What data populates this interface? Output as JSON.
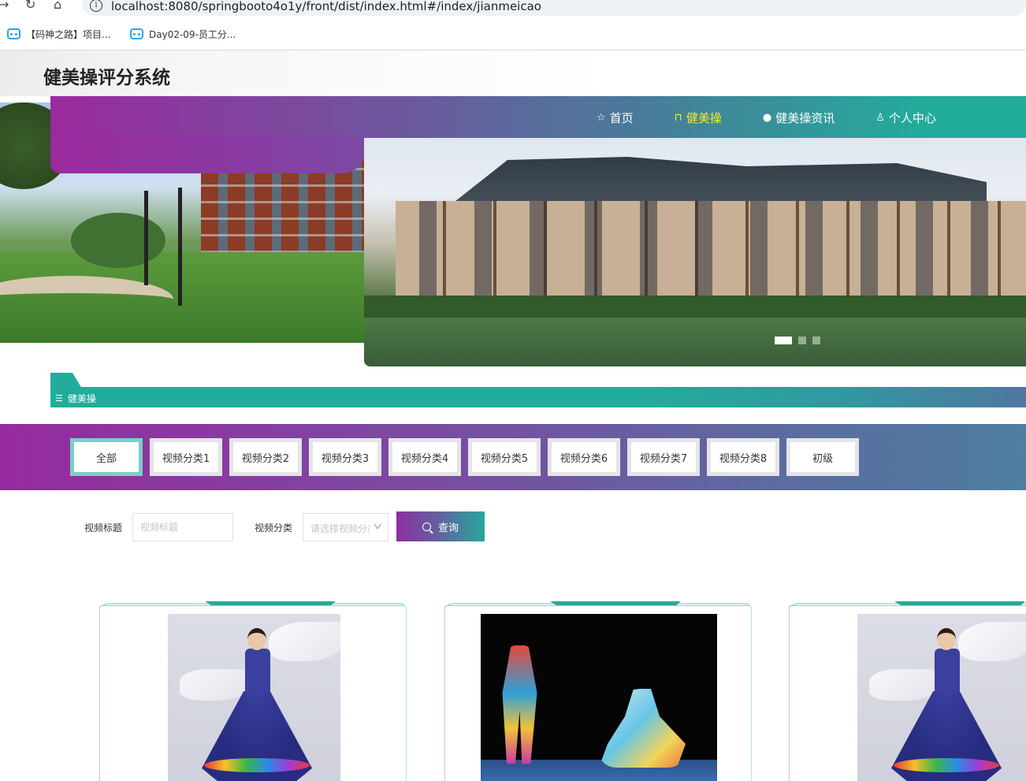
{
  "browser": {
    "url": "localhost:8080/springbooto4o1y/front/dist/index.html#/index/jianmeicao",
    "bookmarks": [
      {
        "label": "【码神之路】项目..."
      },
      {
        "label": "Day02-09-员工分..."
      }
    ]
  },
  "site": {
    "title": "健美操评分系统"
  },
  "nav": {
    "items": [
      {
        "label": "首页",
        "icon": "star-icon"
      },
      {
        "label": "健美操",
        "icon": "bag-icon",
        "active": true
      },
      {
        "label": "健美操资讯",
        "icon": "info-icon"
      },
      {
        "label": "个人中心",
        "icon": "user-icon"
      }
    ]
  },
  "carousel": {
    "slide_count": 3,
    "active_index": 0
  },
  "section": {
    "label": "健美操"
  },
  "categories": {
    "items": [
      "全部",
      "视频分类1",
      "视频分类2",
      "视频分类3",
      "视频分类4",
      "视频分类5",
      "视频分类6",
      "视频分类7",
      "视频分类8",
      "初级"
    ],
    "active_index": 0
  },
  "search": {
    "title_label": "视频标题",
    "title_placeholder": "视频标题",
    "category_label": "视频分类",
    "category_placeholder": "请选择视频分类",
    "button_label": "查询"
  },
  "colors": {
    "purple": "#962aa0",
    "teal": "#22ac9b",
    "nav_active": "#f6ea2a"
  }
}
